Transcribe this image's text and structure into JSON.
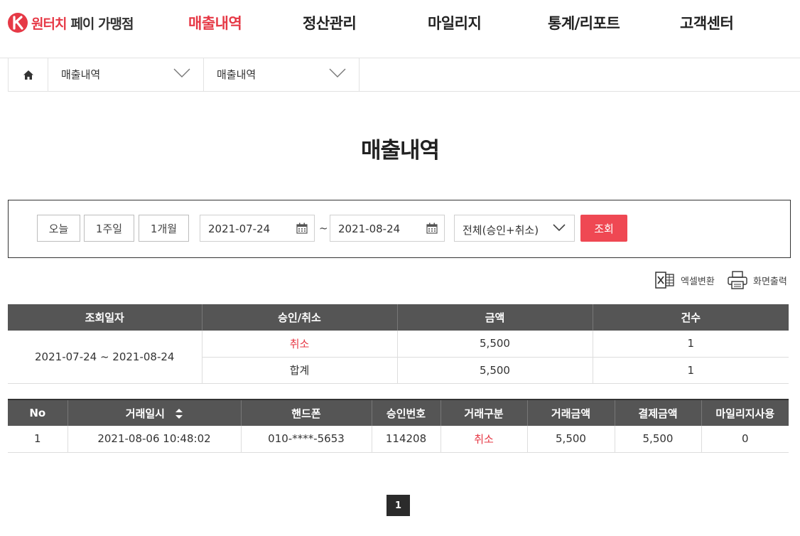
{
  "header": {
    "brand_red": "원터치",
    "brand_dark": "페이 가맹점",
    "nav": [
      {
        "label": "매출내역",
        "active": true
      },
      {
        "label": "정산관리",
        "active": false
      },
      {
        "label": "마일리지",
        "active": false
      },
      {
        "label": "통계/리포트",
        "active": false
      },
      {
        "label": "고객센터",
        "active": false
      }
    ]
  },
  "breadcrumb": {
    "home_icon": "home-icon",
    "level1": "매출내역",
    "level2": "매출내역"
  },
  "page_title": "매출내역",
  "search": {
    "period_buttons": [
      "오늘",
      "1주일",
      "1개월"
    ],
    "date_from": "2021-07-24",
    "date_to": "2021-08-24",
    "separator": "~",
    "type_selected": "전체(승인+취소)",
    "submit_label": "조회"
  },
  "tools": {
    "excel_label": "엑셀변환",
    "print_label": "화면출력"
  },
  "summary": {
    "headers": [
      "조회일자",
      "승인/취소",
      "금액",
      "건수"
    ],
    "period": "2021-07-24 ~ 2021-08-24",
    "rows": [
      {
        "type": "취소",
        "amount": "5,500",
        "count": "1"
      },
      {
        "type": "합계",
        "amount": "5,500",
        "count": "1"
      }
    ]
  },
  "transactions": {
    "headers": [
      "No",
      "거래일시",
      "핸드폰",
      "승인번호",
      "거래구분",
      "거래금액",
      "결제금액",
      "마일리지사용"
    ],
    "rows": [
      {
        "no": "1",
        "datetime": "2021-08-06 10:48:02",
        "phone": "010-****-5653",
        "approval": "114208",
        "kind": "취소",
        "trade_amount": "5,500",
        "pay_amount": "5,500",
        "mileage": "0"
      }
    ]
  },
  "pagination": {
    "current": "1"
  },
  "colors": {
    "accent": "#e63946",
    "button_red": "#ef4853",
    "table_header": "#555555"
  }
}
